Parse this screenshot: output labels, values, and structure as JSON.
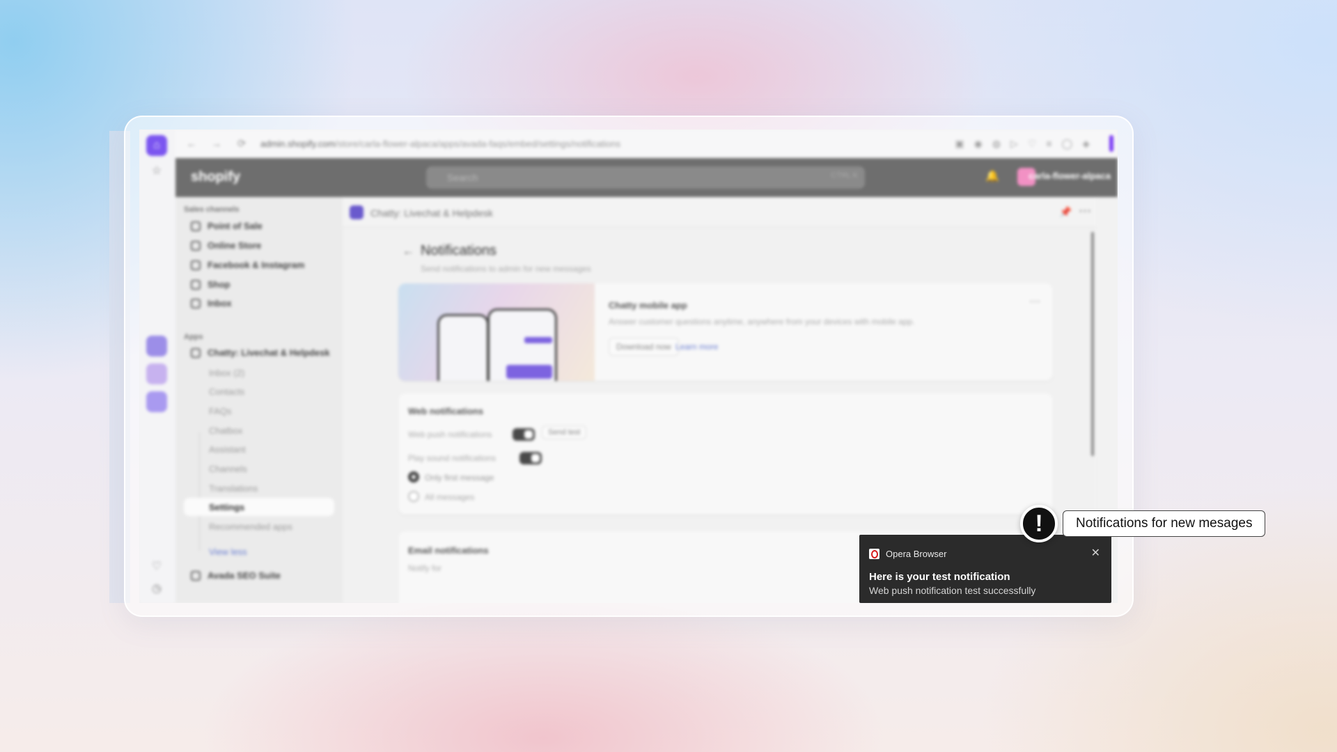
{
  "browser": {
    "url_domain": "admin.shopify.com",
    "url_path": "/store/carla-flower-alpaca/apps/avada-faqs/embed/settings/notifications",
    "nav": {
      "back": "←",
      "forward": "→",
      "reload": "⟳"
    }
  },
  "shopify": {
    "logo": "shopify",
    "search_placeholder": "Search",
    "search_shortcut": "CTRL K",
    "store_name": "carla-flower-alpaca"
  },
  "sidebar": {
    "sales_channels_label": "Sales channels",
    "sales_channels": [
      "Point of Sale",
      "Online Store",
      "Facebook & Instagram",
      "Shop",
      "Inbox"
    ],
    "apps_label": "Apps",
    "app_main": "Chatty: Livechat & Helpdesk",
    "app_subitems": [
      "Inbox (2)",
      "Contacts",
      "FAQs",
      "Chatbox",
      "Assistant",
      "Channels",
      "Translations",
      "Settings",
      "Recommended apps"
    ],
    "view_less": "View less",
    "other_app": "Avada SEO Suite"
  },
  "app_header": {
    "title": "Chatty: Livechat & Helpdesk"
  },
  "page": {
    "title": "Notifications",
    "subtitle": "Send notifications to admin for new messages"
  },
  "promo_card": {
    "title": "Chatty mobile app",
    "text": "Answer customer questions anytime, anywhere from your devices with mobile app.",
    "download_btn": "Download now",
    "learn_more": "Learn more"
  },
  "web_notifications": {
    "title": "Web notifications",
    "push_label": "Web push notifications",
    "send_test_btn": "Send test",
    "sound_label": "Play sound notifications",
    "option_first": "Only first message",
    "option_all": "All messages"
  },
  "email_notifications": {
    "title": "Email notifications",
    "notify_for": "Notify for"
  },
  "toast": {
    "app_name": "Opera Browser",
    "title": "Here is your test notification",
    "body": "Web push notification test successfully",
    "close": "✕"
  },
  "callout": {
    "icon": "!",
    "text": "Notifications for new mesages"
  }
}
